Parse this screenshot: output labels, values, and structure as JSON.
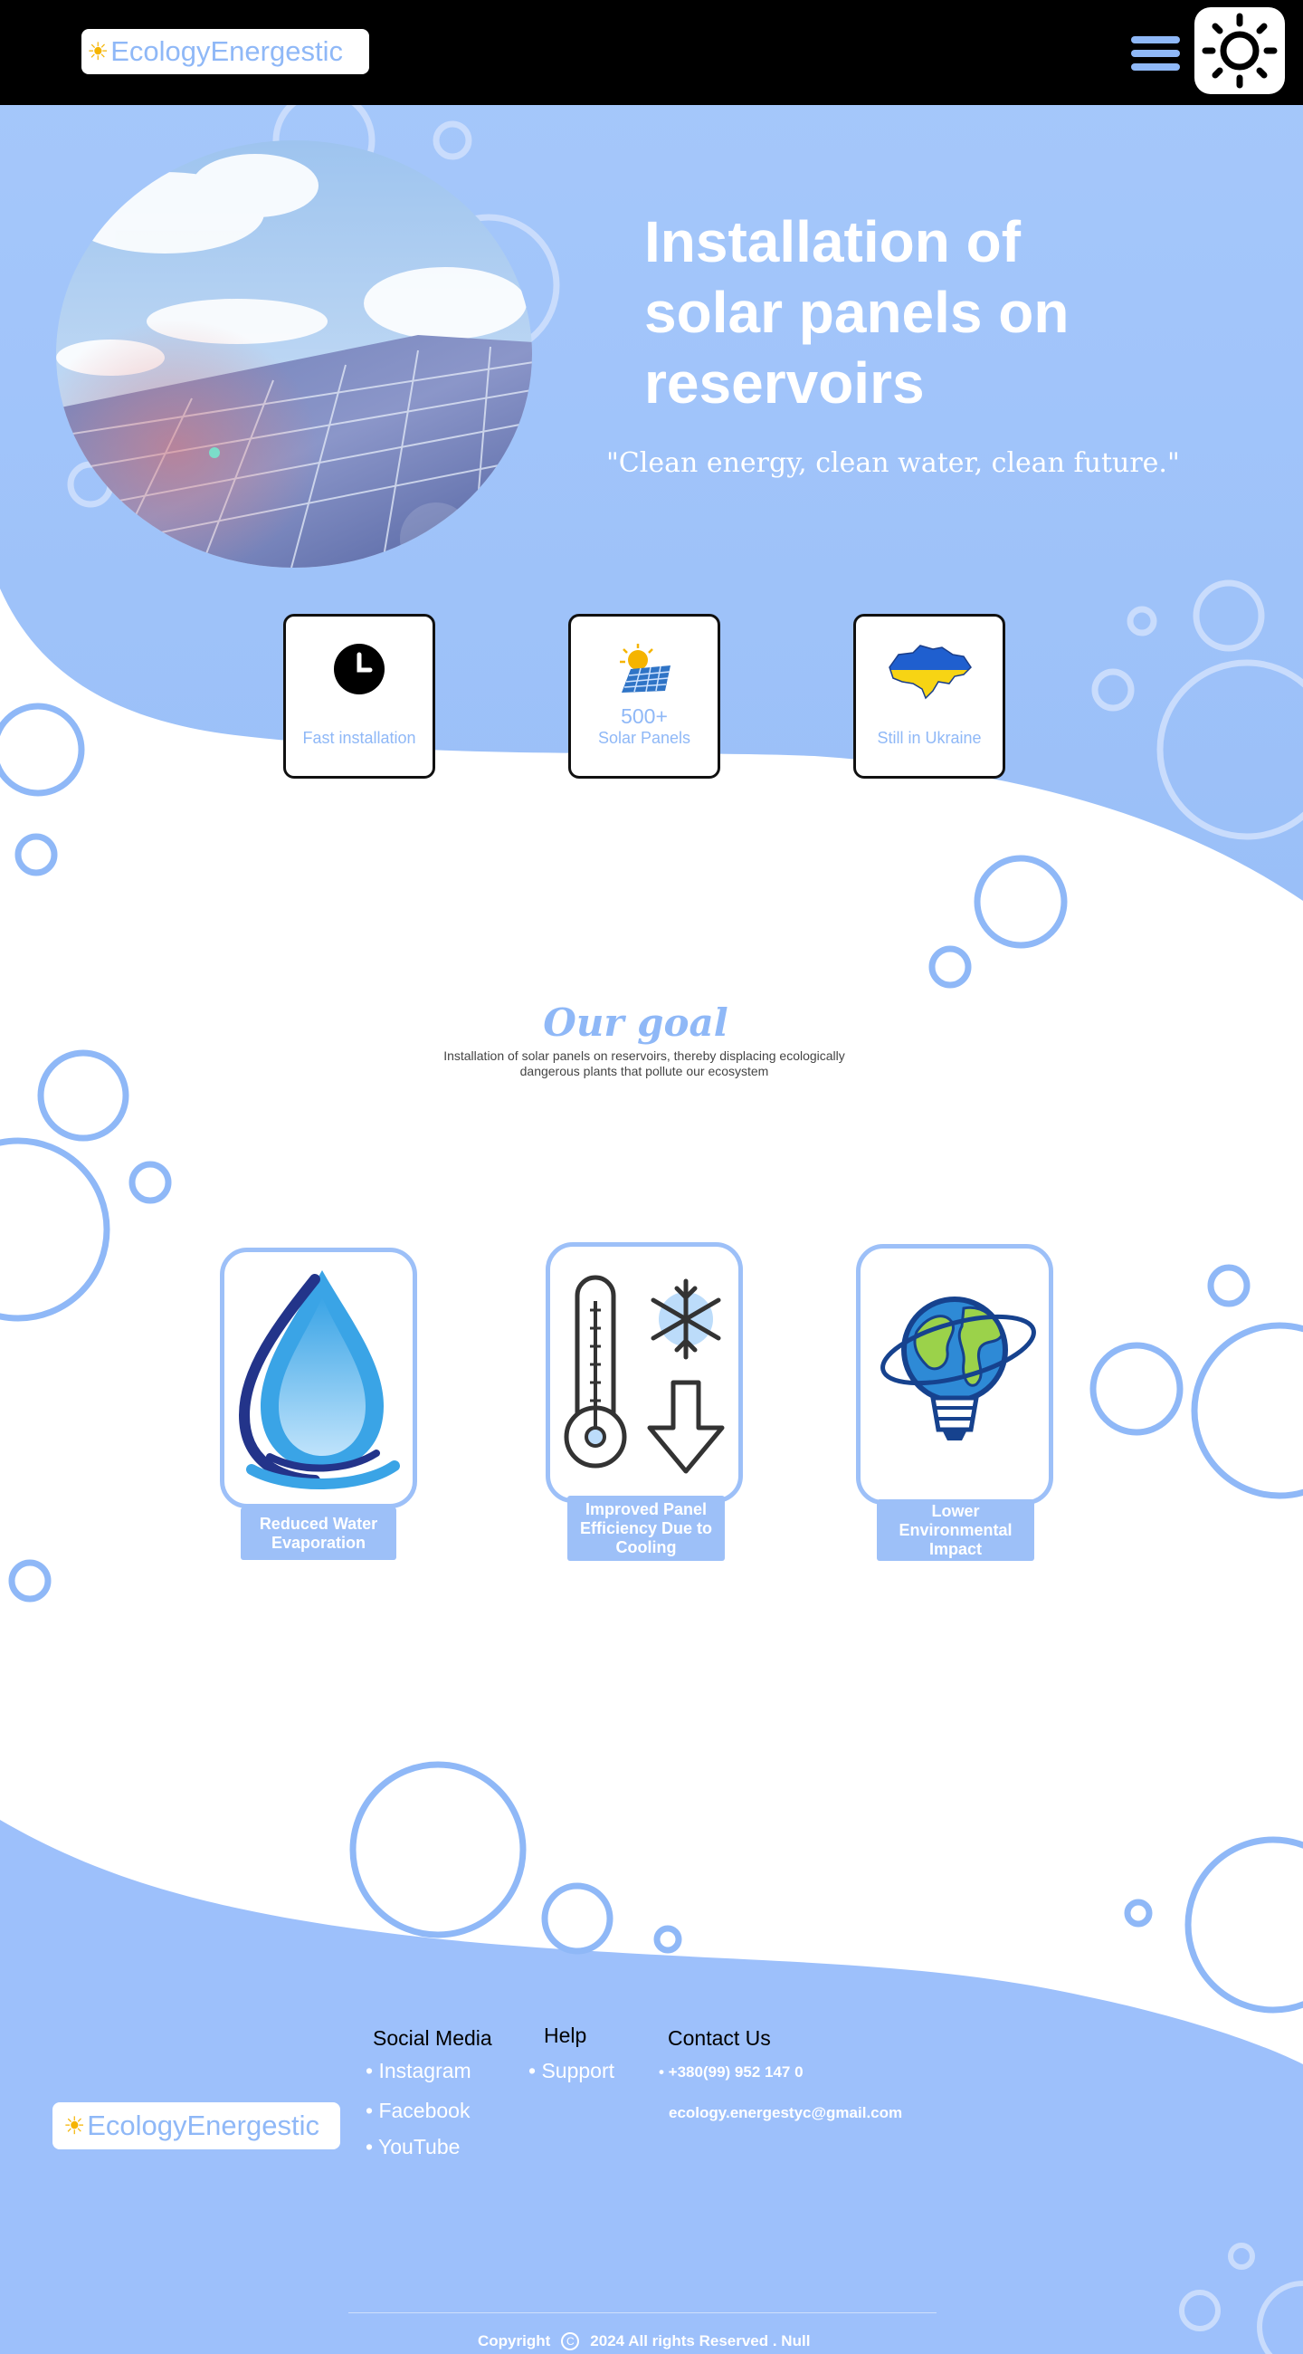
{
  "header": {
    "logo_text": "EcologyEnergestic",
    "logo_icon": "sun-icon",
    "menu_icon": "hamburger-menu-icon",
    "theme_icon": "sun-toggle-icon"
  },
  "hero": {
    "title": "Installation of solar panels on reservoirs",
    "quote": "\"Clean energy, clean water, clean future.\""
  },
  "stats": [
    {
      "icon": "clock-icon",
      "number": "",
      "label": "Fast installation"
    },
    {
      "icon": "solar-panel-icon",
      "number": "500+",
      "label": "Solar Panels"
    },
    {
      "icon": "ukraine-map-icon",
      "number": "",
      "label": "Still in Ukraine"
    }
  ],
  "goal": {
    "title": "Our goal",
    "text": "Installation of solar panels on reservoirs, thereby displacing ecologically dangerous plants that pollute our ecosystem"
  },
  "benefits": [
    {
      "icon": "water-drop-hand-icon",
      "label": "Reduced Water Evaporation"
    },
    {
      "icon": "thermometer-snowflake-icon",
      "label": "Improved Panel Efficiency Due to Cooling"
    },
    {
      "icon": "earth-bulb-icon",
      "label": "Lower Environmental Impact"
    }
  ],
  "footer": {
    "logo_text": "EcologyEnergestic",
    "social": {
      "title": "Social Media",
      "links": [
        "• Instagram",
        "• Facebook",
        "• YouTube"
      ]
    },
    "help": {
      "title": "Help",
      "links": [
        "• Support"
      ]
    },
    "contact": {
      "title": "Contact Us",
      "phone": "• +380(99) 952 147 0",
      "email": "ecology.energestyc@gmail.com"
    },
    "copyright_left": "Copyright",
    "copyright_symbol": "C",
    "copyright_right": "2024 All rights Reserved . Null"
  },
  "colors": {
    "brand_blue": "#8fb8f7",
    "hero_bg": "#a3c6fb",
    "header_bg": "#000000",
    "sun": "#f5b400"
  }
}
